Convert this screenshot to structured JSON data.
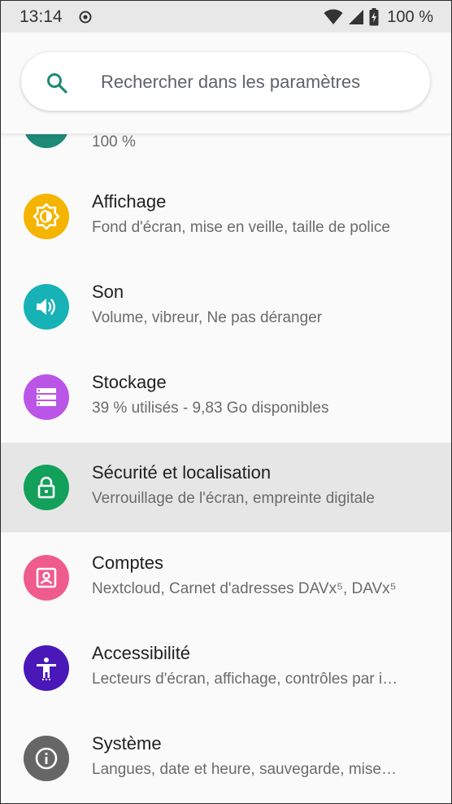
{
  "status_bar": {
    "time": "13:14",
    "battery_percent": "100 %"
  },
  "search": {
    "placeholder": "Rechercher dans les paramètres"
  },
  "partial_item": {
    "subtitle": "100 %",
    "icon": "battery-icon",
    "color": "#1e8a78"
  },
  "items": [
    {
      "title": "Affichage",
      "subtitle": "Fond d'écran, mise en veille, taille de police",
      "icon": "brightness-icon",
      "color": "#f5b400"
    },
    {
      "title": "Son",
      "subtitle": "Volume, vibreur, Ne pas déranger",
      "icon": "volume-icon",
      "color": "#17b2b5"
    },
    {
      "title": "Stockage",
      "subtitle": "39 % utilisés - 9,83 Go disponibles",
      "icon": "storage-icon",
      "color": "#bb55e8"
    },
    {
      "title": "Sécurité et localisation",
      "subtitle": "Verrouillage de l'écran, empreinte digitale",
      "icon": "lock-icon",
      "color": "#12a05b",
      "selected": true
    },
    {
      "title": "Comptes",
      "subtitle": "Nextcloud, Carnet d'adresses DAVx⁵, DAVx⁵",
      "icon": "account-icon",
      "color": "#ef5b8c"
    },
    {
      "title": "Accessibilité",
      "subtitle": "Lecteurs d'écran, affichage, contrôles par i…",
      "icon": "accessibility-icon",
      "color": "#4a18b8"
    },
    {
      "title": "Système",
      "subtitle": "Langues, date et heure, sauvegarde, mise…",
      "icon": "info-icon",
      "color": "#666666"
    }
  ]
}
